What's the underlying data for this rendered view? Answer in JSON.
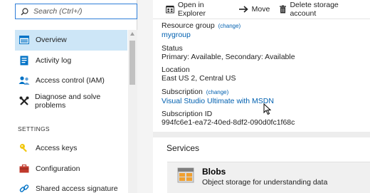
{
  "search": {
    "placeholder": "Search (Ctrl+/)"
  },
  "menu": {
    "items": [
      {
        "label": "Overview",
        "icon": "overview-icon"
      },
      {
        "label": "Activity log",
        "icon": "activity-log-icon"
      },
      {
        "label": "Access control (IAM)",
        "icon": "access-control-icon"
      },
      {
        "label": "Diagnose and solve problems",
        "icon": "diagnose-icon"
      }
    ],
    "settings_header": "SETTINGS",
    "settings_items": [
      {
        "label": "Access keys",
        "icon": "key-icon"
      },
      {
        "label": "Configuration",
        "icon": "configuration-icon"
      },
      {
        "label": "Shared access signature",
        "icon": "link-icon"
      }
    ]
  },
  "toolbar": {
    "open_explorer": "Open in Explorer",
    "move": "Move",
    "delete": "Delete storage account"
  },
  "essentials": {
    "resource_group_label": "Resource group",
    "change": "(change)",
    "resource_group_value": "mygroup",
    "status_label": "Status",
    "status_value": "Primary: Available, Secondary: Available",
    "location_label": "Location",
    "location_value": "East US 2, Central US",
    "subscription_label": "Subscription",
    "subscription_value": "Visual Studio Ultimate with MSDN",
    "subscription_id_label": "Subscription ID",
    "subscription_id_value": "994fc6e1-ea72-40ed-8df2-090d0fc1f68c"
  },
  "services": {
    "title": "Services",
    "blobs_name": "Blobs",
    "blobs_desc": "Object storage for understanding data"
  },
  "colors": {
    "accent": "#0060b0",
    "selected": "#cde6f7",
    "search_border": "#2f7ed8"
  }
}
